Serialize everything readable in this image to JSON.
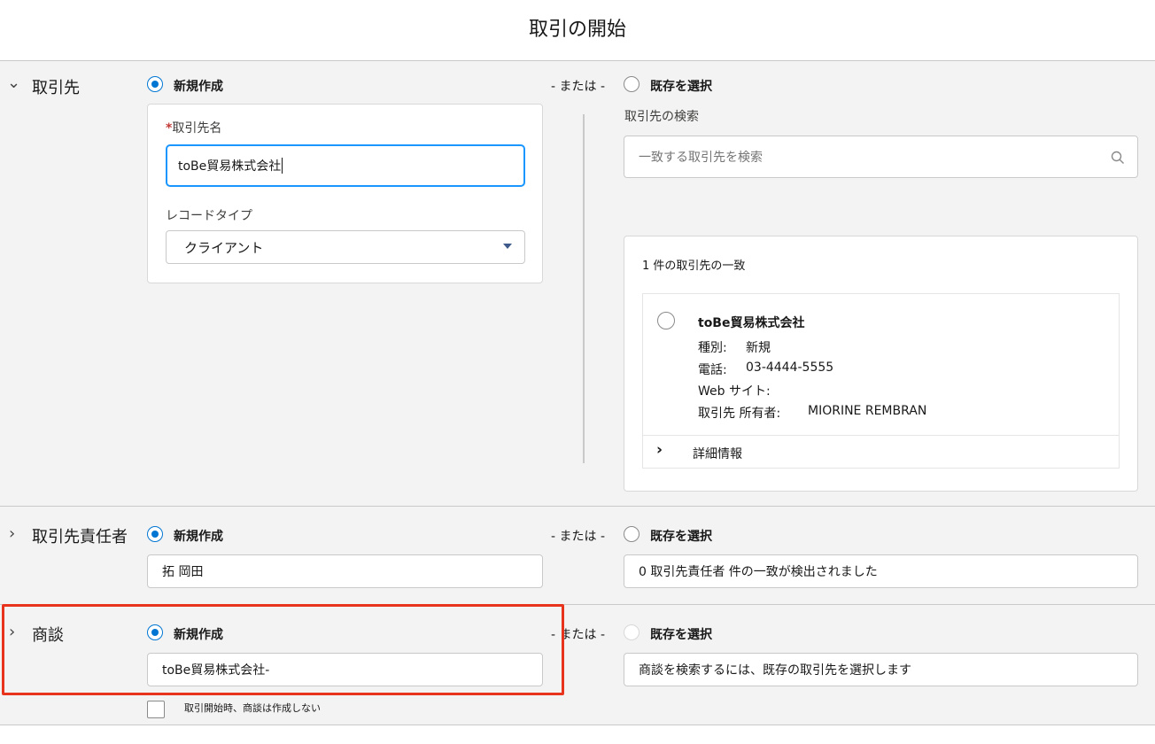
{
  "page_title": "取引の開始",
  "or_text": "- または -",
  "account": {
    "label": "取引先",
    "new_label": "新規作成",
    "existing_label": "既存を選択",
    "name_field_label": "取引先名",
    "name_value": "toBe貿易株式会社",
    "record_type_label": "レコードタイプ",
    "record_type_value": "クライアント",
    "search_label": "取引先の検索",
    "search_placeholder": "一致する取引先を検索",
    "match_count_text": "1 件の取引先の一致",
    "match": {
      "name": "toBe貿易株式会社",
      "type_label": "種別:",
      "type_value": "新規",
      "phone_label": "電話:",
      "phone_value": "03-4444-5555",
      "web_label": "Web サイト:",
      "owner_label": "取引先 所有者:",
      "owner_value": "MIORINE REMBRAN",
      "details_label": "詳細情報"
    }
  },
  "contact": {
    "label": "取引先責任者",
    "new_label": "新規作成",
    "existing_label": "既存を選択",
    "name_value": "拓 岡田",
    "match_text": "0 取引先責任者 件の一致が検出されました"
  },
  "opportunity": {
    "label": "商談",
    "new_label": "新規作成",
    "existing_label": "既存を選択",
    "name_value": "toBe貿易株式会社-",
    "search_text": "商談を検索するには、既存の取引先を選択します",
    "checkbox_label": "取引開始時、商談は作成しない"
  },
  "colors": {
    "accent": "#0176d3",
    "highlight": "#e8341c",
    "section_bg": "#f3f3f3"
  }
}
